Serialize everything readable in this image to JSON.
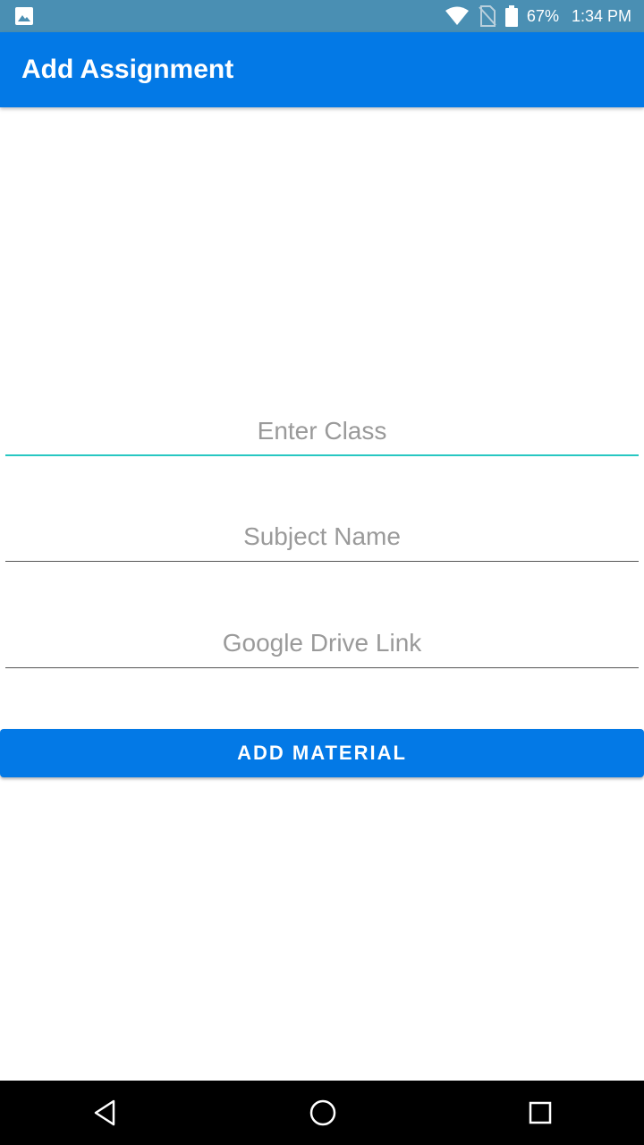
{
  "status_bar": {
    "battery": "67%",
    "time": "1:34 PM",
    "icons": [
      "gallery-icon",
      "wifi-icon",
      "no-sim-icon",
      "battery-icon"
    ]
  },
  "app_bar": {
    "title": "Add Assignment"
  },
  "form": {
    "class_field": {
      "placeholder": "Enter Class",
      "value": ""
    },
    "subject_field": {
      "placeholder": "Subject Name",
      "value": ""
    },
    "drive_field": {
      "placeholder": "Google Drive Link",
      "value": ""
    },
    "submit_label": "ADD MATERIAL"
  },
  "nav_bar": {
    "icons": [
      "back-icon",
      "home-icon",
      "recent-apps-icon"
    ]
  },
  "colors": {
    "status_bar": "#4a8fb3",
    "primary": "#0379e6",
    "focus_accent": "#27c7c2"
  }
}
